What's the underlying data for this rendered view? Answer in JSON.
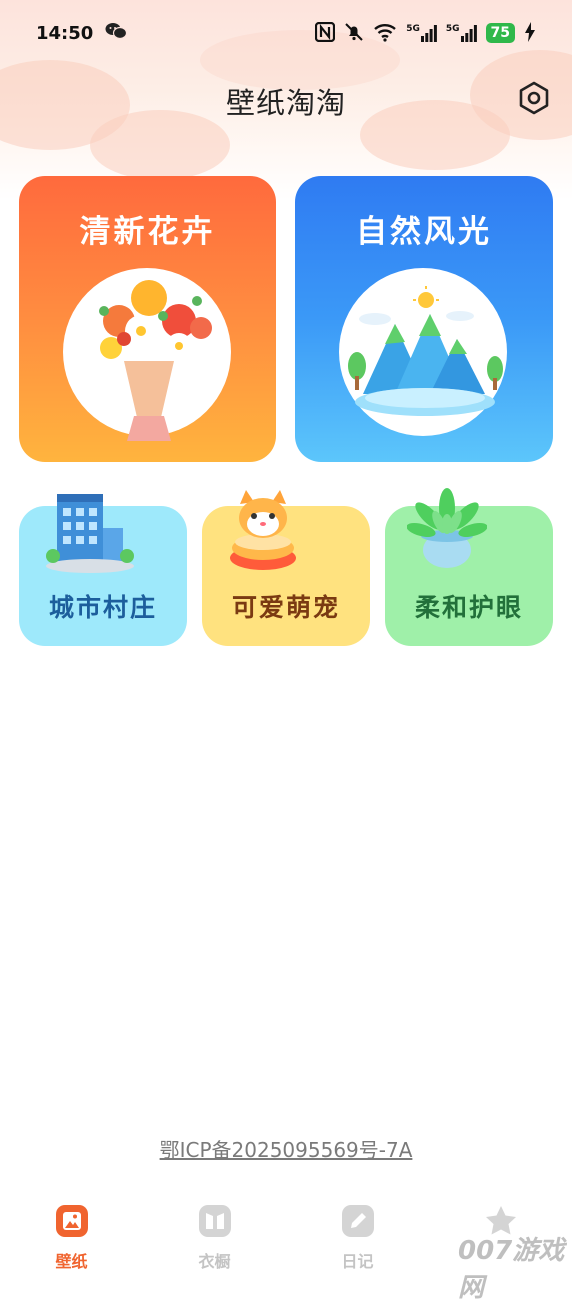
{
  "status_bar": {
    "time": "14:50",
    "network_5g_1": "5G",
    "network_5g_2": "5G",
    "battery": "75"
  },
  "header": {
    "title": "壁纸淘淘"
  },
  "categories_large": [
    {
      "label": "清新花卉",
      "gradient_start": "#ff6a3d",
      "gradient_end": "#ffb43e"
    },
    {
      "label": "自然风光",
      "gradient_start": "#2f7bf2",
      "gradient_end": "#5cc6fb"
    }
  ],
  "categories_small": [
    {
      "label": "城市村庄",
      "bg": "#9ee9fb",
      "text_color": "#1c5e9c"
    },
    {
      "label": "可爱萌宠",
      "bg": "#ffe27f",
      "text_color": "#7a3a12"
    },
    {
      "label": "柔和护眼",
      "bg": "#9ff0a9",
      "text_color": "#22703a"
    }
  ],
  "footer": {
    "icp": "鄂ICP备2025095569号-7A"
  },
  "tabbar": {
    "active_color": "#f0642f",
    "inactive_color": "#c9c9c9",
    "items": [
      {
        "label": "壁纸",
        "icon": "wallpaper-icon",
        "active": true
      },
      {
        "label": "衣橱",
        "icon": "wardrobe-icon",
        "active": false
      },
      {
        "label": "日记",
        "icon": "diary-icon",
        "active": false
      },
      {
        "label": "",
        "icon": "star-icon",
        "active": false
      }
    ]
  },
  "watermark": "007游戏网"
}
